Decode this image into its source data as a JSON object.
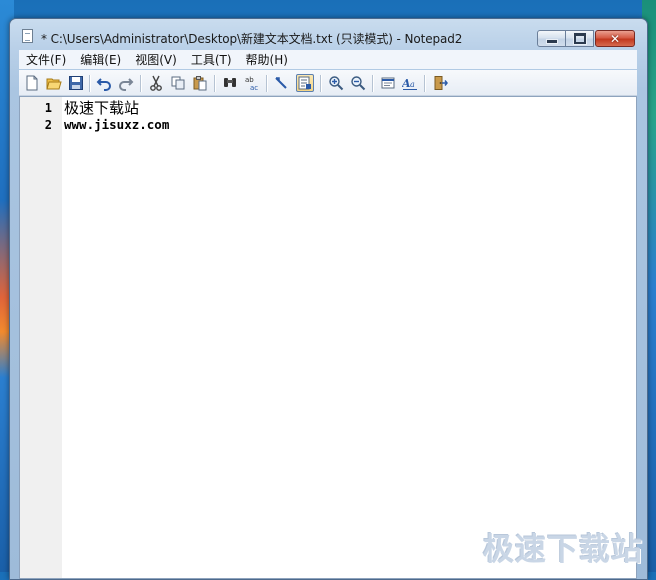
{
  "window": {
    "title": "* C:\\Users\\Administrator\\Desktop\\新建文本文档.txt (只读模式) - Notepad2",
    "controls": {
      "minimize": "minimize",
      "maximize": "maximize",
      "close": "close"
    }
  },
  "menu": {
    "items": [
      {
        "label": "文件(F)"
      },
      {
        "label": "编辑(E)"
      },
      {
        "label": "视图(V)"
      },
      {
        "label": "工具(T)"
      },
      {
        "label": "帮助(H)"
      }
    ]
  },
  "toolbar": {
    "buttons": [
      {
        "icon": "new-file-icon"
      },
      {
        "icon": "open-folder-icon"
      },
      {
        "icon": "save-icon"
      },
      {
        "icon": "undo-icon"
      },
      {
        "icon": "redo-icon"
      },
      {
        "icon": "cut-icon"
      },
      {
        "icon": "copy-icon"
      },
      {
        "icon": "paste-icon"
      },
      {
        "icon": "find-icon"
      },
      {
        "icon": "replace-icon"
      },
      {
        "icon": "word-wrap-icon"
      },
      {
        "icon": "readonly-toggle-icon",
        "pressed": true
      },
      {
        "icon": "zoom-in-icon"
      },
      {
        "icon": "zoom-out-icon"
      },
      {
        "icon": "settings-icon"
      },
      {
        "icon": "font-icon"
      },
      {
        "icon": "exit-icon"
      }
    ]
  },
  "editor": {
    "lines": [
      {
        "number": "1",
        "text": "极速下载站"
      },
      {
        "number": "2",
        "text": "www.jisuxz.com"
      }
    ]
  },
  "watermark": {
    "text": "极速下载站"
  },
  "colors": {
    "accent": "#2a86d0",
    "close_button": "#c2391f",
    "gutter": "#f0f0f0",
    "editor_bg": "#ffffff"
  }
}
